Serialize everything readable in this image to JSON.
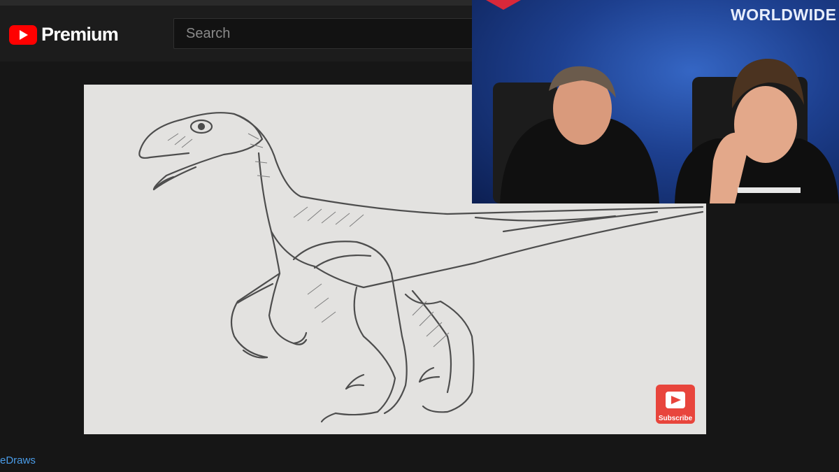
{
  "header": {
    "logo_text": "Premium",
    "search_placeholder": "Search"
  },
  "video": {
    "subscribe_label": "Subscribe"
  },
  "webcam": {
    "brand_text": "WORLDWIDE"
  },
  "channel": {
    "name": "eDraws"
  },
  "colors": {
    "youtube_red": "#ff0000",
    "link_blue": "#4a9ce8",
    "subscribe_red": "#e8453c",
    "paper": "#e3e2e0"
  }
}
